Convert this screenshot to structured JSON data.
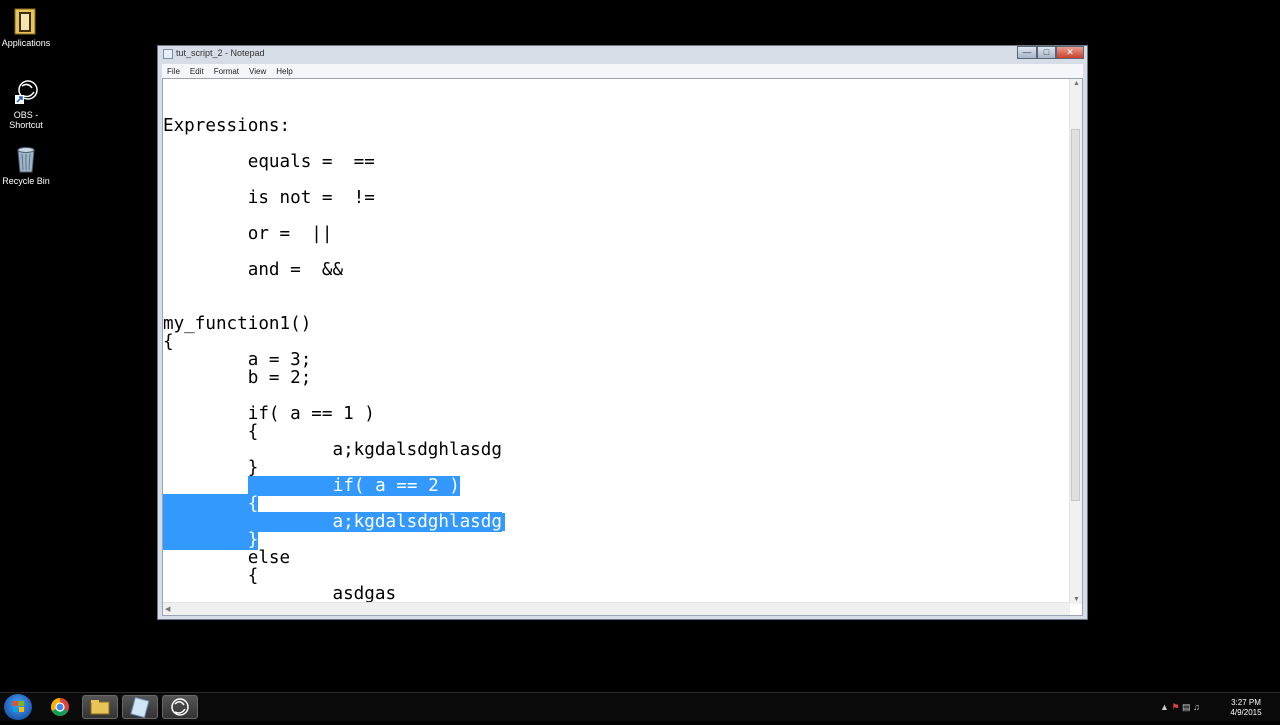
{
  "desktop": {
    "icons": [
      {
        "label": "Applications"
      },
      {
        "label": "OBS - Shortcut"
      },
      {
        "label": "Recycle Bin"
      }
    ]
  },
  "window": {
    "title": "tut_script_2 - Notepad",
    "menu": [
      "File",
      "Edit",
      "Format",
      "View",
      "Help"
    ]
  },
  "editor": {
    "lines": [
      "Expressions:",
      "        equals =  ==",
      "        is not =  !=",
      "        or =  ||",
      "        and =  &&",
      "my_function1()",
      "{",
      "        a = 3;",
      "        b = 2;",
      "        if( a == 1 )",
      "        {",
      "                a;kgdalsdghlasdg",
      "        }",
      "        if( a == 2 )",
      "        {",
      "                a;kgdalsdghlasdg",
      "        }",
      "        else",
      "        {",
      "                asdgas"
    ]
  },
  "taskbar": {
    "time": "3:27 PM",
    "date": "4/9/2015"
  },
  "colors": {
    "selection": "#3399ff",
    "desktop": "#000000"
  }
}
